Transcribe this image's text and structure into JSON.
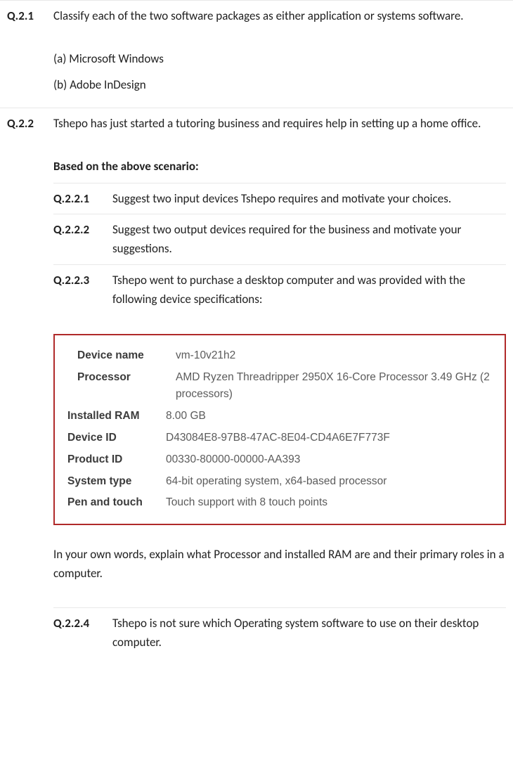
{
  "q21": {
    "num": "Q.2.1",
    "text": "Classify each of the two software packages as either application or systems software.",
    "a": "(a) Microsoft Windows",
    "b": "(b) Adobe InDesign"
  },
  "q22": {
    "num": "Q.2.2",
    "text": "Tshepo has just started a tutoring business and requires help in setting up a home office.",
    "scenario_heading": "Based on the above scenario:",
    "sub": {
      "n1": "Q.2.2.1",
      "t1": "Suggest two input devices Tshepo requires and motivate your choices.",
      "n2": "Q.2.2.2",
      "t2": "Suggest two output devices required for the business and motivate your suggestions.",
      "n3": "Q.2.2.3",
      "t3": "Tshepo went to purchase a desktop computer and was provided with the following device specifications:",
      "n4": "Q.2.2.4",
      "t4": "Tshepo is not sure which Operating system software to use on their desktop computer."
    },
    "followup": "In your own words, explain what Processor and installed RAM are and their primary roles in a computer."
  },
  "spec": {
    "rows": [
      {
        "label": "Device name",
        "value": "vm-10v21h2"
      },
      {
        "label": "Processor",
        "value": "AMD Ryzen Threadripper 2950X 16-Core Processor 3.49 GHz  (2 processors)"
      },
      {
        "label": "Installed RAM",
        "value": "8.00 GB"
      },
      {
        "label": "Device ID",
        "value": "D43084E8-97B8-47AC-8E04-CD4A6E7F773F"
      },
      {
        "label": "Product ID",
        "value": "00330-80000-00000-AA393"
      },
      {
        "label": "System type",
        "value": "64-bit operating system, x64-based processor"
      },
      {
        "label": "Pen and touch",
        "value": "Touch support with 8 touch points"
      }
    ]
  }
}
